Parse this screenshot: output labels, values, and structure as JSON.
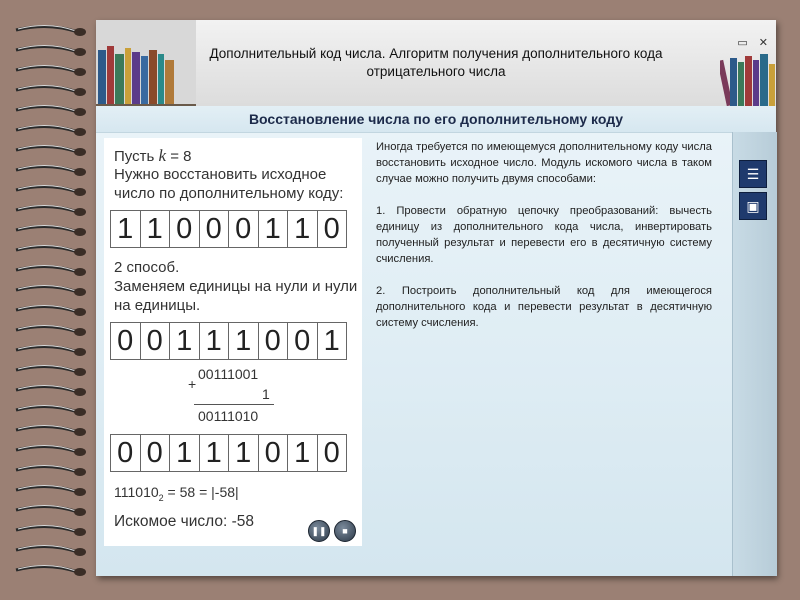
{
  "header": {
    "title_line1": "Дополнительный код числа. Алгоритм получения дополнительного кода",
    "title_line2": "отрицательного числа",
    "window_controls": "▭ ✕"
  },
  "subtitle": "Восстановление числа по его дополнительному коду",
  "left_panel": {
    "intro_prefix": "Пусть",
    "variable": "k",
    "intro_suffix": "= 8",
    "text_line2": "Нужно восстановить исходное",
    "text_line3": "число по дополнительному коду:",
    "bits1": [
      "1",
      "1",
      "0",
      "0",
      "0",
      "1",
      "1",
      "0"
    ],
    "method_line1": "2 способ.",
    "method_line2": "Заменяем единицы на нули и нули",
    "method_line3": "на единицы.",
    "bits2": [
      "0",
      "0",
      "1",
      "1",
      "1",
      "0",
      "0",
      "1"
    ],
    "addition": {
      "plus": "+",
      "operand1": "00111001",
      "operand2": "1",
      "result": "00111010"
    },
    "bits3": [
      "0",
      "0",
      "1",
      "1",
      "1",
      "0",
      "1",
      "0"
    ],
    "conversion_main": "111010",
    "conversion_sub": "2",
    "conversion_rest": " = 58 = |-58|",
    "answer": "Искомое число: -58"
  },
  "right_text": {
    "p1": "Иногда требуется по имеющемуся дополнительному коду числа восстановить исходное число. Модуль искомого числа в таком случае можно получить двумя способами:",
    "p2": "1. Провести обратную цепочку преобразований: вычесть единицу из дополнительного кода числа, инвертировать полученный результат и перевести его в десятичную систему счисления.",
    "p3": "2. Построить дополнительный код для имеющегося дополнительного кода и перевести результат в десятичную систему счисления."
  },
  "controls": {
    "pause_icon": "pause-icon",
    "stop_icon": "stop-icon",
    "pause_glyph": "❚❚",
    "stop_glyph": "■"
  },
  "side_tools": {
    "list_icon": "list-icon",
    "save_icon": "save-icon",
    "list_glyph": "☰",
    "save_glyph": "▣"
  },
  "colors": {
    "background": "#9b8074",
    "tool_button": "#1f3a6d",
    "subtitle_text": "#1c2a4a"
  }
}
